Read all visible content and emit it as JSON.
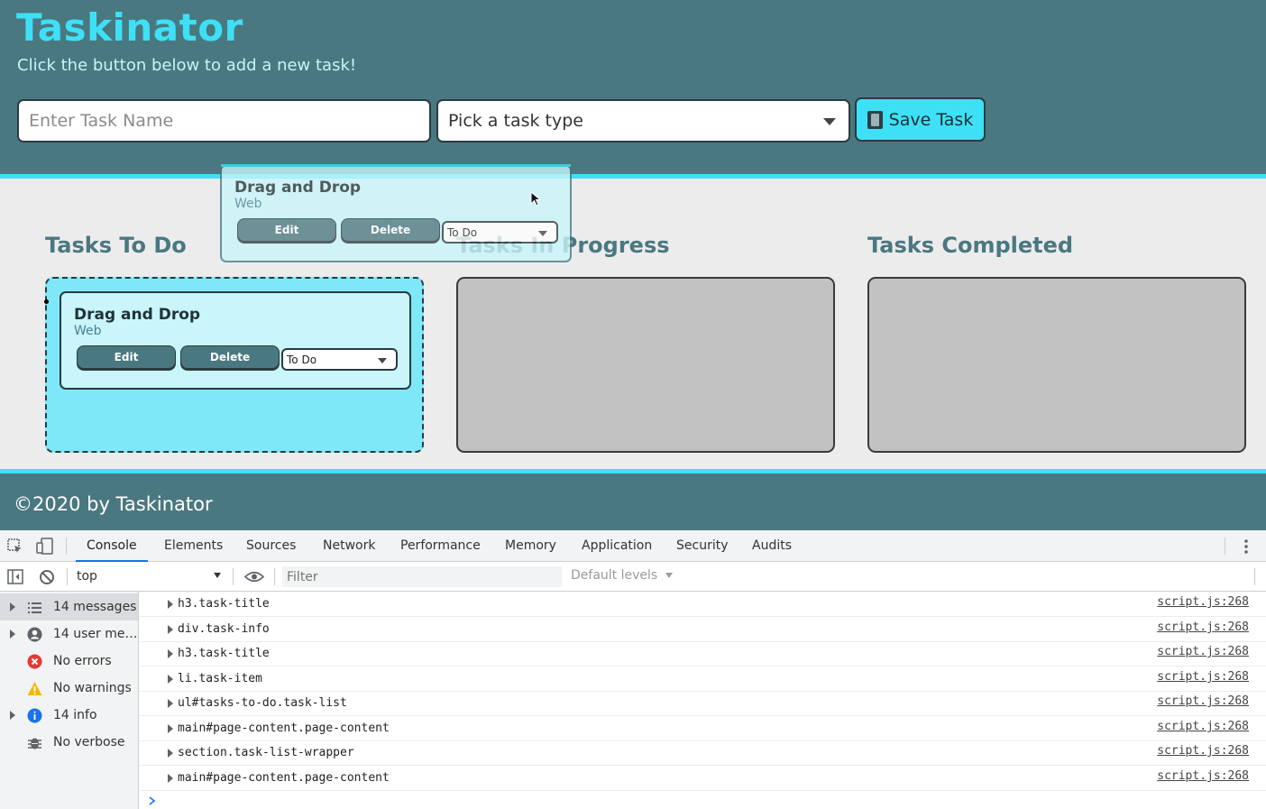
{
  "header": {
    "title": "Taskinator",
    "subtitle": "Click the button below to add a new task!",
    "task_input_placeholder": "Enter Task Name",
    "task_type_placeholder": "Pick a task type",
    "save_label": "Save Task"
  },
  "columns": [
    {
      "title": "Tasks To Do"
    },
    {
      "title": "Tasks In Progress"
    },
    {
      "title": "Tasks Completed"
    }
  ],
  "task": {
    "name": "Drag and Drop",
    "type": "Web",
    "edit_label": "Edit",
    "delete_label": "Delete",
    "status": "To Do"
  },
  "footer": {
    "text": "©2020 by Taskinator"
  },
  "devtools": {
    "tabs": [
      "Console",
      "Elements",
      "Sources",
      "Network",
      "Performance",
      "Memory",
      "Application",
      "Security",
      "Audits"
    ],
    "active_tab": "Console",
    "context": "top",
    "filter_placeholder": "Filter",
    "levels": "Default levels",
    "sidebar": [
      {
        "label": "14 messages",
        "icon": "list-icon"
      },
      {
        "label": "14 user me…",
        "icon": "user-icon"
      },
      {
        "label": "No errors",
        "icon": "error-icon"
      },
      {
        "label": "No warnings",
        "icon": "warning-icon"
      },
      {
        "label": "14 info",
        "icon": "info-icon"
      },
      {
        "label": "No verbose",
        "icon": "bug-icon"
      }
    ],
    "logs": [
      {
        "text": "h3.task-title",
        "source": "script.js:268"
      },
      {
        "text": "div.task-info",
        "source": "script.js:268"
      },
      {
        "text": "h3.task-title",
        "source": "script.js:268"
      },
      {
        "text": "li.task-item",
        "source": "script.js:268"
      },
      {
        "text": "ul#tasks-to-do.task-list",
        "source": "script.js:268"
      },
      {
        "text": "main#page-content.page-content",
        "source": "script.js:268"
      },
      {
        "text": "section.task-list-wrapper",
        "source": "script.js:268"
      },
      {
        "text": "main#page-content.page-content",
        "source": "script.js:268"
      }
    ]
  },
  "colors": {
    "header_bg": "#4a7880",
    "accent": "#3ee0f6",
    "todo_bg": "#7ee8f8",
    "card_bg": "#c9f5fb"
  }
}
